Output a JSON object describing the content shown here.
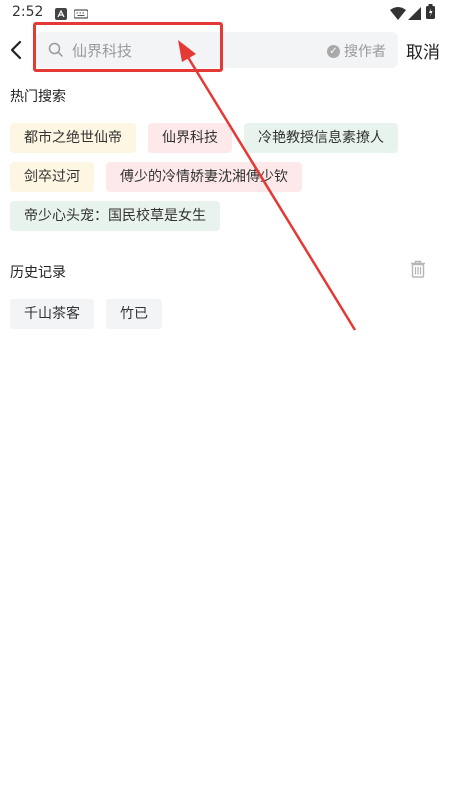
{
  "status": {
    "time": "2:52"
  },
  "search": {
    "placeholder": "仙界科技",
    "filter_label": "搜作者",
    "cancel_label": "取消"
  },
  "hot": {
    "title": "热门搜索",
    "tags": [
      {
        "label": "都市之绝世仙帝",
        "color": "yellow"
      },
      {
        "label": "仙界科技",
        "color": "pink"
      },
      {
        "label": "冷艳教授信息素撩人",
        "color": "green"
      },
      {
        "label": "剑卒过河",
        "color": "yellow"
      },
      {
        "label": "傅少的冷情娇妻沈湘傅少钦",
        "color": "pink"
      },
      {
        "label": "帝少心头宠：国民校草是女生",
        "color": "green"
      }
    ]
  },
  "history": {
    "title": "历史记录",
    "items": [
      {
        "label": "千山茶客"
      },
      {
        "label": "竹已"
      }
    ]
  },
  "colors": {
    "highlight": "#e53935",
    "tag_yellow": "#fdf6e3",
    "tag_pink": "#fde9ea",
    "tag_green": "#e9f3ed",
    "tag_grey": "#f3f4f6"
  },
  "icons": {
    "back": "chevron-left-icon",
    "search": "search-icon",
    "check": "check-circle-icon",
    "trash": "trash-icon"
  }
}
